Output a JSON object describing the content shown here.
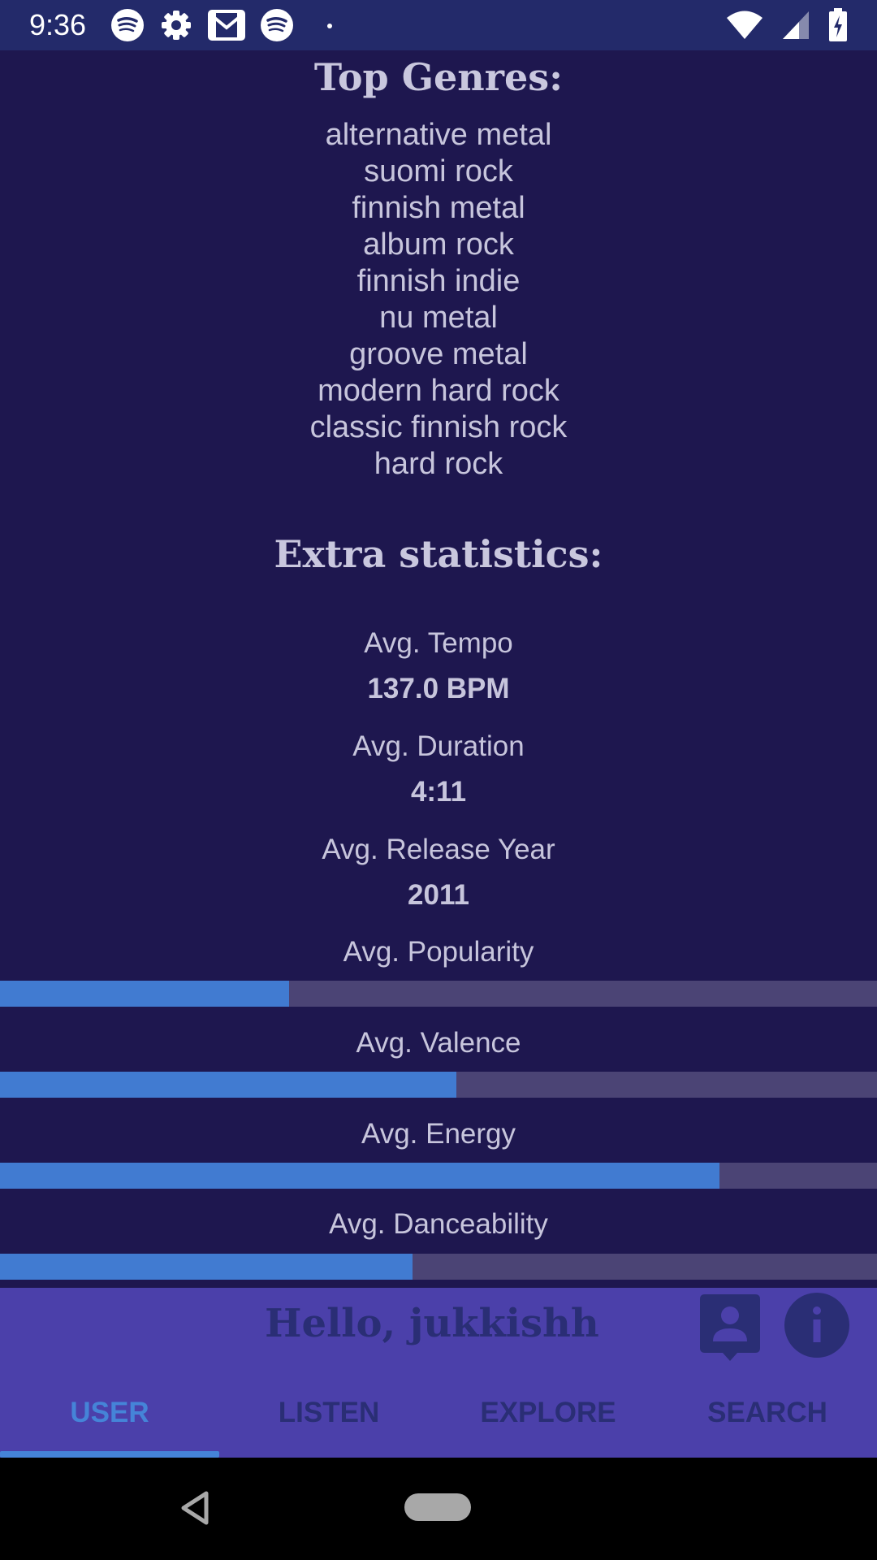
{
  "status_bar": {
    "time": "9:36",
    "icons_left": [
      "spotify-icon",
      "settings-gear-icon",
      "gmail-icon",
      "spotify-icon",
      "dot-icon"
    ],
    "icons_right": [
      "wifi-icon",
      "cellular-signal-icon",
      "battery-charging-icon"
    ]
  },
  "top_genres": {
    "title": "Top Genres:",
    "items": [
      "alternative metal",
      "suomi rock",
      "finnish metal",
      "album rock",
      "finnish indie",
      "nu metal",
      "groove metal",
      "modern hard rock",
      "classic finnish rock",
      "hard rock"
    ]
  },
  "extra_statistics": {
    "title": "Extra statistics:",
    "tempo": {
      "label": "Avg. Tempo",
      "value": "137.0 BPM"
    },
    "duration": {
      "label": "Avg. Duration",
      "value": "4:11"
    },
    "release_year": {
      "label": "Avg. Release Year",
      "value": "2011"
    },
    "bars": [
      {
        "label": "Avg. Popularity",
        "fraction": 0.33
      },
      {
        "label": "Avg. Valence",
        "fraction": 0.52
      },
      {
        "label": "Avg. Energy",
        "fraction": 0.82
      },
      {
        "label": "Avg. Danceability",
        "fraction": 0.47
      }
    ]
  },
  "app_bar": {
    "greeting": "Hello, jukkishh",
    "tabs": [
      {
        "label": "USER",
        "active": true
      },
      {
        "label": "LISTEN",
        "active": false
      },
      {
        "label": "EXPLORE",
        "active": false
      },
      {
        "label": "SEARCH",
        "active": false
      }
    ]
  },
  "colors": {
    "background": "#1e174f",
    "status_bar": "#232a6a",
    "app_bar": "#4b40aa",
    "accent": "#4584d8",
    "bar_track": "#4b4475",
    "text": "#c7c5dc",
    "dark_text": "#2a2e75"
  }
}
